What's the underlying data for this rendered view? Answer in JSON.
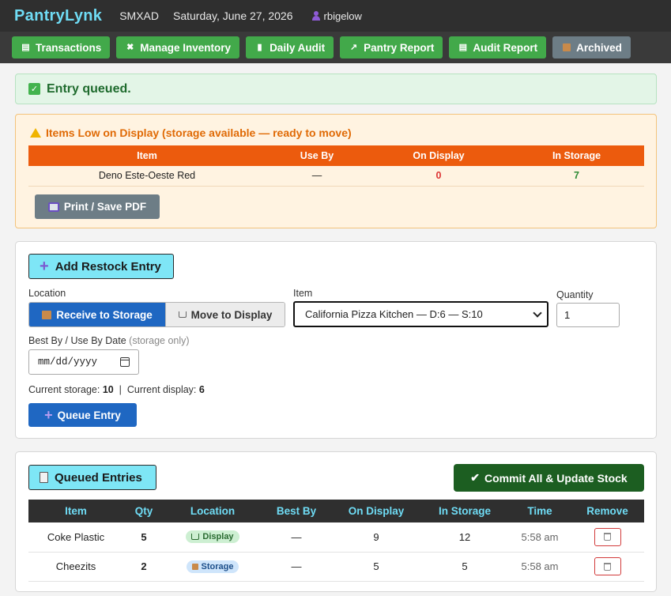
{
  "header": {
    "brand": "PantryLynk",
    "site_code": "SMXAD",
    "date": "Saturday, June 27, 2026",
    "user": "rbigelow",
    "brand_color": "#6fdcf5"
  },
  "nav": {
    "items": [
      {
        "label": "Transactions",
        "icon": "clipboard-icon"
      },
      {
        "label": "Manage Inventory",
        "icon": "tools-icon"
      },
      {
        "label": "Daily Audit",
        "icon": "bar-chart-icon"
      },
      {
        "label": "Pantry Report",
        "icon": "line-chart-icon"
      },
      {
        "label": "Audit Report",
        "icon": "clipboard-icon"
      },
      {
        "label": "Archived",
        "icon": "box-icon"
      }
    ]
  },
  "alert": {
    "text": "Entry queued."
  },
  "low_display": {
    "title": "Items Low on Display (storage available — ready to move)",
    "columns": [
      "Item",
      "Use By",
      "On Display",
      "In Storage"
    ],
    "rows": [
      {
        "item": "Deno Este-Oeste Red",
        "use_by": "—",
        "on_display": "0",
        "in_storage": "7"
      }
    ],
    "print_label": "Print / Save PDF"
  },
  "restock": {
    "title": "Add Restock Entry",
    "location_label": "Location",
    "location_options": [
      "Receive to Storage",
      "Move to Display"
    ],
    "item_label": "Item",
    "item_value": "California Pizza Kitchen — D:6 — S:10",
    "quantity_label": "Quantity",
    "quantity_value": "1",
    "date_label": "Best By / Use By Date",
    "date_hint": "(storage only)",
    "date_placeholder": "mm/dd/yyyy",
    "current_storage_label": "Current storage:",
    "current_storage_value": "10",
    "current_display_label": "Current display:",
    "current_display_value": "6",
    "queue_label": "Queue Entry"
  },
  "queued": {
    "title": "Queued Entries",
    "commit_label": "Commit All & Update Stock",
    "columns": [
      "Item",
      "Qty",
      "Location",
      "Best By",
      "On Display",
      "In Storage",
      "Time",
      "Remove"
    ],
    "rows": [
      {
        "item": "Coke Plastic",
        "qty": "5",
        "location": "Display",
        "best_by": "—",
        "on_display": "9",
        "in_storage": "12",
        "time": "5:58 am"
      },
      {
        "item": "Cheezits",
        "qty": "2",
        "location": "Storage",
        "best_by": "—",
        "on_display": "5",
        "in_storage": "5",
        "time": "5:58 am"
      }
    ]
  }
}
